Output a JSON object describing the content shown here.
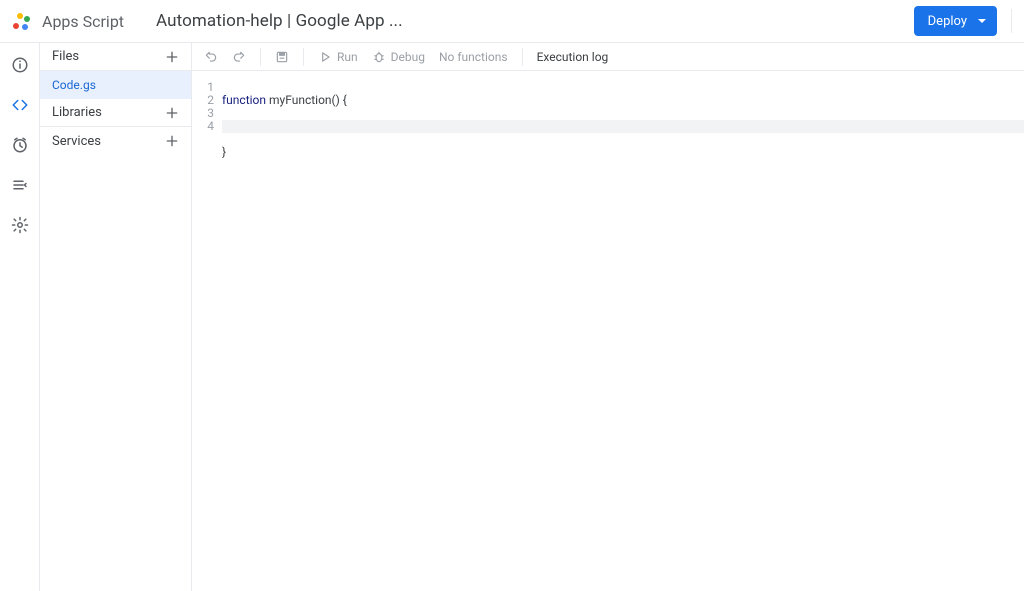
{
  "header": {
    "product_name": "Apps Script",
    "project_title": "Automation-help | Google App ...",
    "deploy_label": "Deploy"
  },
  "rail": {
    "items": [
      {
        "name": "overview",
        "icon": "info"
      },
      {
        "name": "editor",
        "icon": "code",
        "active": true
      },
      {
        "name": "triggers",
        "icon": "clock"
      },
      {
        "name": "executions",
        "icon": "list"
      },
      {
        "name": "settings",
        "icon": "gear"
      }
    ]
  },
  "sidebar": {
    "files_label": "Files",
    "libraries_label": "Libraries",
    "services_label": "Services",
    "files": [
      {
        "name": "Code.gs",
        "selected": true
      }
    ]
  },
  "toolbar": {
    "run_label": "Run",
    "debug_label": "Debug",
    "func_label": "No functions",
    "execlog_label": "Execution log"
  },
  "code": {
    "line_numbers": [
      "1",
      "2",
      "3",
      "4"
    ],
    "l1_kw": "function",
    "l1_rest": " myFunction() {",
    "l2": "  ",
    "l3": "}",
    "l4": "",
    "highlight_line_index": 3
  }
}
